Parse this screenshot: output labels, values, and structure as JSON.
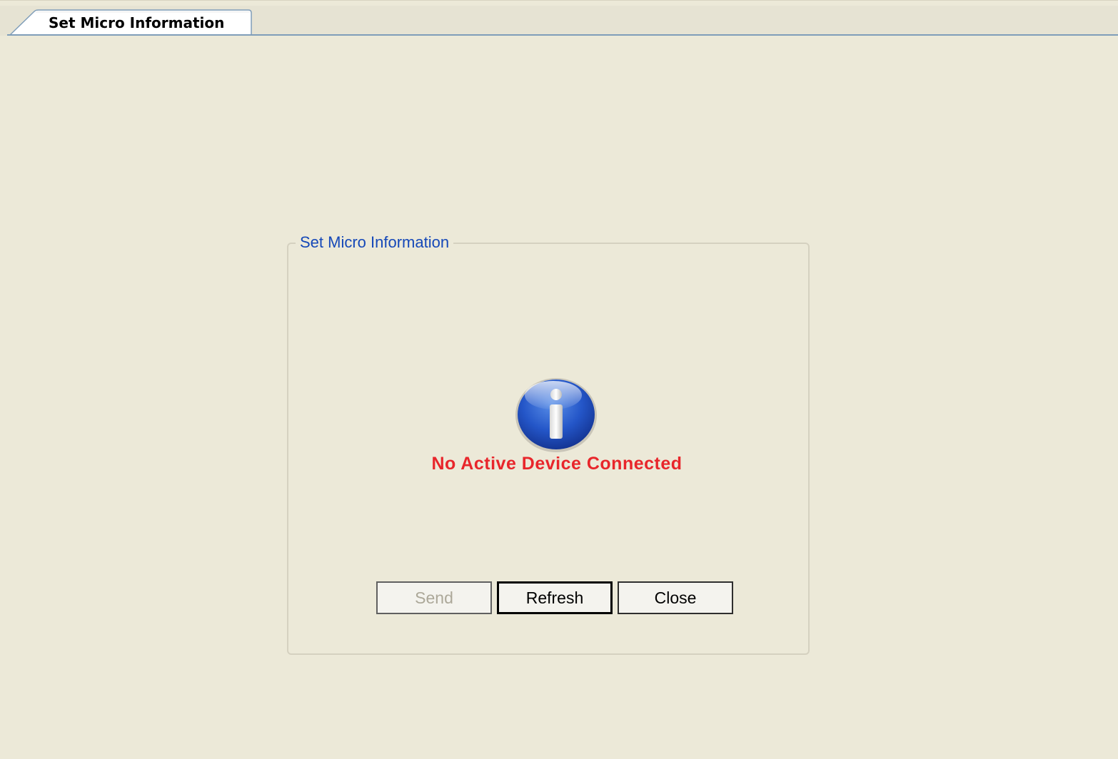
{
  "tab": {
    "label": "Set Micro Information"
  },
  "groupbox": {
    "title": "Set Micro Information"
  },
  "status": {
    "icon": "information-icon",
    "message": "No Active Device Connected",
    "message_color": "#E8262B"
  },
  "buttons": {
    "send": {
      "label": "Send",
      "enabled": false
    },
    "refresh": {
      "label": "Refresh",
      "enabled": true
    },
    "close": {
      "label": "Close",
      "enabled": true
    }
  },
  "colors": {
    "background": "#ECE9D8",
    "groupbox_title": "#1548B8",
    "tab_border": "#7F9DB9"
  }
}
